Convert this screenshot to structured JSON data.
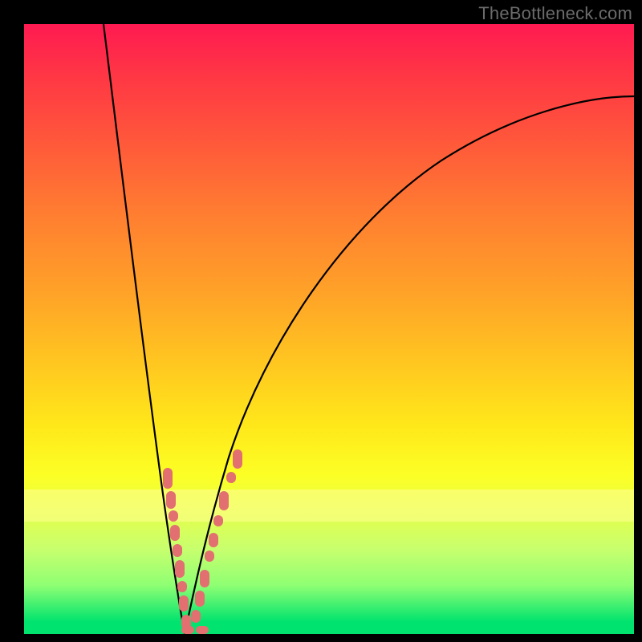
{
  "watermark": "TheBottleneck.com",
  "chart_data": {
    "type": "line",
    "title": "",
    "xlabel": "",
    "ylabel": "",
    "xlim": [
      0,
      100
    ],
    "ylim": [
      0,
      100
    ],
    "series": [
      {
        "name": "curve-left",
        "x": [
          13,
          15,
          17,
          19,
          21,
          23,
          24,
          25,
          26
        ],
        "y": [
          100,
          80,
          60,
          42,
          26,
          12,
          6,
          2,
          0
        ]
      },
      {
        "name": "curve-right",
        "x": [
          26,
          28,
          30,
          33,
          38,
          45,
          55,
          70,
          85,
          100
        ],
        "y": [
          0,
          4,
          12,
          25,
          42,
          56,
          67,
          77,
          83,
          88
        ]
      }
    ],
    "annotations": {
      "salmon_dot_clusters": {
        "left_branch_y_range": [
          2,
          28
        ],
        "right_branch_y_range": [
          2,
          30
        ]
      }
    }
  }
}
